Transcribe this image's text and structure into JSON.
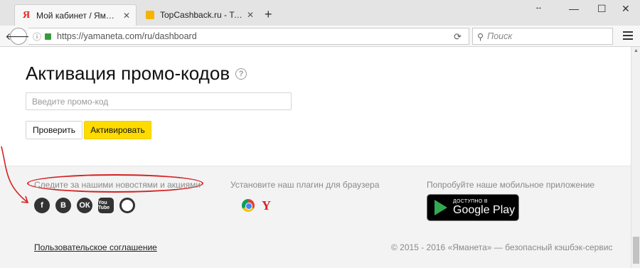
{
  "browser": {
    "tabs": [
      {
        "favicon": "yandex-ya-icon",
        "title": "Мой кабинет / Яманета ...",
        "active": true
      },
      {
        "favicon": "lock-favicon-icon",
        "title": "TopCashback.ru - Топ лу...",
        "active": false
      }
    ],
    "new_tab": "+",
    "url": "https://yamaneta.com/ru/dashboard",
    "search_placeholder": "Поиск"
  },
  "promo": {
    "title": "Активация промо-кодов",
    "input_placeholder": "Введите промо-код",
    "check_label": "Проверить",
    "activate_label": "Активировать"
  },
  "footer": {
    "news_text": "Следите за нашими новостями и акциями",
    "socials": [
      {
        "name": "facebook-icon",
        "glyph": "f"
      },
      {
        "name": "vk-icon",
        "glyph": "B"
      },
      {
        "name": "odnoklassniki-icon",
        "glyph": "ОК"
      },
      {
        "name": "youtube-icon",
        "glyph": "You\nTube"
      },
      {
        "name": "instagram-icon",
        "glyph": ""
      }
    ],
    "plugin_text": "Установите наш плагин для браузера",
    "mobile_text": "Попробуйте наше мобильное приложение",
    "gplay_top": "ДОСТУПНО В",
    "gplay_bottom": "Google Play",
    "agreement": "Пользовательское соглашение",
    "copyright": "© 2015 - 2016 «Яманета» — безопасный кэшбэк-сервис"
  },
  "colors": {
    "accent_yellow": "#ffdb00",
    "annotation_red": "#d62020"
  }
}
